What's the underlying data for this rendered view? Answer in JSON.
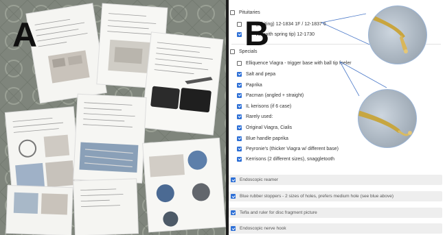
{
  "labels": {
    "a": "A",
    "b": "B"
  },
  "pituitaries": {
    "heading": "Pituitaries",
    "items": [
      {
        "text": "(p-biting) 12-1834 1F / 12-1837 6",
        "checked": false
      },
      {
        "text": "ved with spring tip) 12-1730",
        "checked": true
      }
    ]
  },
  "specials": {
    "heading": "Specials",
    "items": [
      {
        "text": "Elliquence Viagra - trigger base with ball tip feeler",
        "checked": false
      },
      {
        "text": "Salt and pepa",
        "checked": true
      },
      {
        "text": "Paprika",
        "checked": true
      },
      {
        "text": "Pacman (angled + straight)",
        "checked": true
      },
      {
        "text": "IL kerisons (if 6 case)",
        "checked": true
      },
      {
        "text": "Rarely used:",
        "checked": true
      },
      {
        "text": "Original Viagra, Cialis",
        "checked": true
      },
      {
        "text": "Blue handle paprika",
        "checked": true
      },
      {
        "text": "Peyronie's (thicker Viagra w/ different base)",
        "checked": true
      },
      {
        "text": "Kerrisons (2 different sizes), snaggletooth",
        "checked": true
      }
    ]
  },
  "bottom_items": [
    {
      "text": "Endoscopic reamer",
      "checked": true
    },
    {
      "text": "Blue rubber stoppers - 2 sizes of holes, prefers medium hole (see blue above)",
      "checked": true
    },
    {
      "text": "Tefla and ruler for disc fragment picture",
      "checked": true
    },
    {
      "text": "Endoscopic nerve hook",
      "checked": true
    }
  ],
  "colors": {
    "check": "#2d6fd6",
    "callout_line": "#4a78c8",
    "photo_background": "#8a8f86"
  }
}
